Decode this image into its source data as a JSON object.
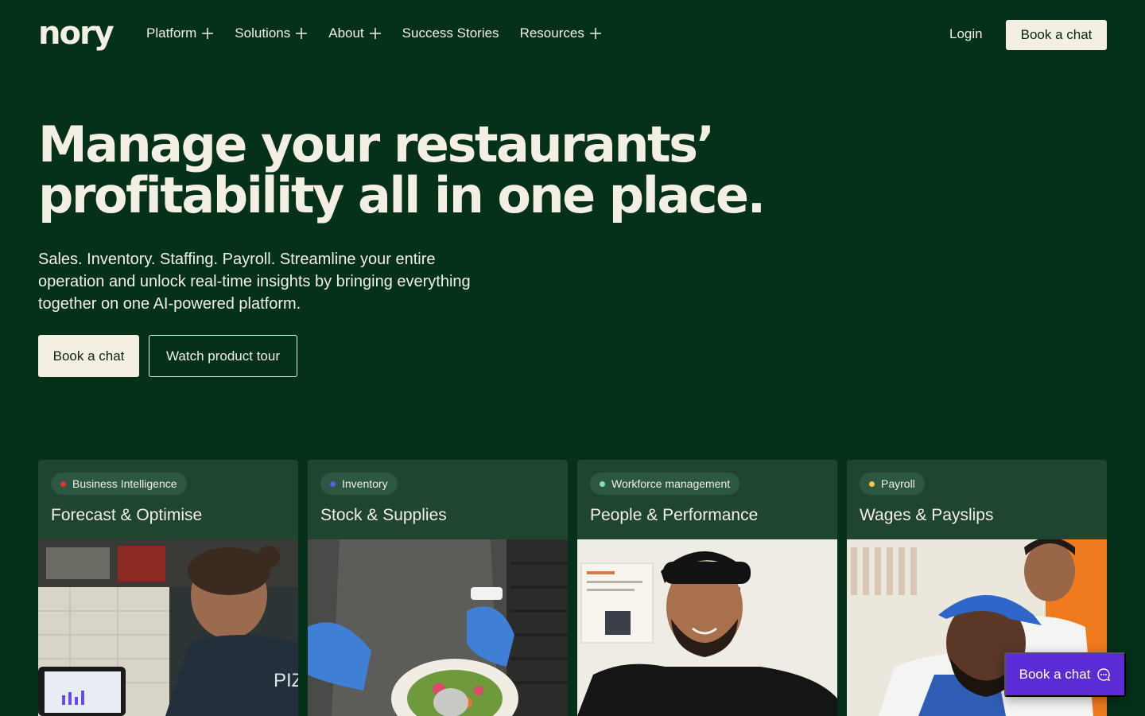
{
  "header": {
    "logo": "nory",
    "menu": [
      {
        "label": "Platform",
        "has_plus": true
      },
      {
        "label": "Solutions",
        "has_plus": true
      },
      {
        "label": "About",
        "has_plus": true
      },
      {
        "label": "Success Stories",
        "has_plus": false
      },
      {
        "label": "Resources",
        "has_plus": true
      }
    ],
    "login": "Login",
    "cta": "Book a chat"
  },
  "hero": {
    "title_line1": "Manage your restaurants’",
    "title_line2": "profitability all in one place.",
    "subtitle": "Sales. Inventory. Staffing. Payroll. Streamline your entire operation and unlock real-time insights by bringing everything together on one AI-powered platform.",
    "primary_cta": "Book a chat",
    "secondary_cta": "Watch product tour"
  },
  "cards": [
    {
      "tag": "Business Intelligence",
      "dot_color": "#e8322e",
      "title": "Forecast & Optimise"
    },
    {
      "tag": "Inventory",
      "dot_color": "#5a5cf0",
      "title": "Stock & Supplies"
    },
    {
      "tag": "Workforce management",
      "dot_color": "#7fe0b5",
      "title": "People & Performance"
    },
    {
      "tag": "Payroll",
      "dot_color": "#f5c542",
      "title": "Wages & Payslips"
    }
  ],
  "floating_chat": {
    "label": "Book a chat",
    "icon": "chat-bubble-icon"
  },
  "colors": {
    "background": "#05301a",
    "card": "#1f4530",
    "cream": "#f4efe3",
    "chat_purple": "#5b2bd6"
  }
}
